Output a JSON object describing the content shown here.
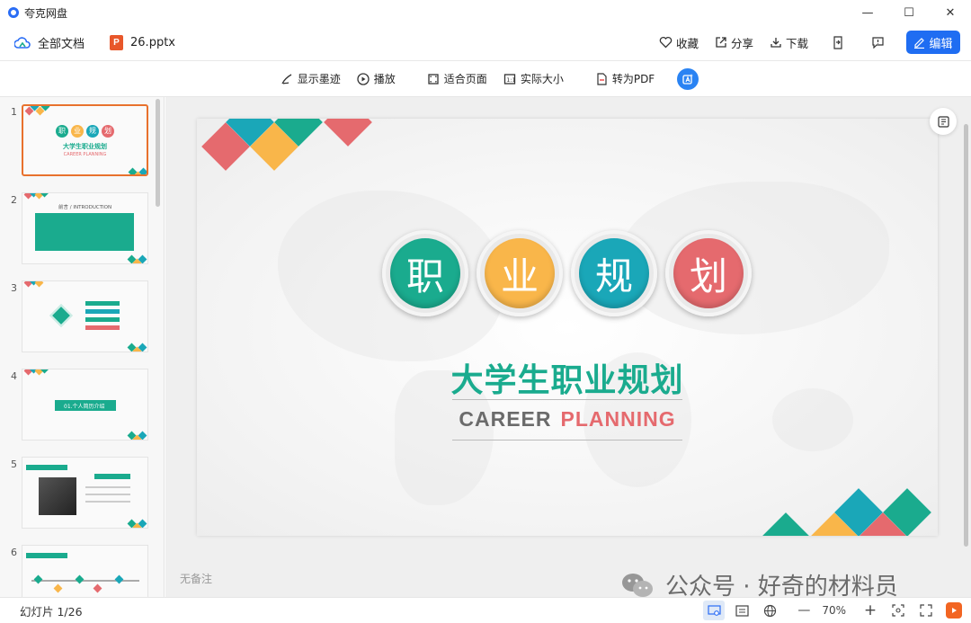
{
  "window": {
    "title": "夸克网盘",
    "minimize": "—",
    "maximize": "☐",
    "close": "✕"
  },
  "nav": {
    "all_docs": "全部文档",
    "file_name": "26.pptx",
    "file_icon_letter": "P",
    "actions": {
      "favorite": "收藏",
      "share": "分享",
      "download": "下载"
    },
    "edit": "编辑"
  },
  "toolbar": {
    "show_ink": "显示墨迹",
    "play": "播放",
    "fit_page": "适合页面",
    "actual_size": "实际大小",
    "to_pdf": "转为PDF"
  },
  "thumbnails": [
    {
      "num": "1",
      "title": "大学生职业规划",
      "sub": "CAREER PLANNING"
    },
    {
      "num": "2",
      "title": "前言 / INTRODUCTION"
    },
    {
      "num": "3"
    },
    {
      "num": "4",
      "title": "01.个人简历介绍"
    },
    {
      "num": "5"
    },
    {
      "num": "6"
    }
  ],
  "slide": {
    "chars": [
      "职",
      "业",
      "规",
      "划"
    ],
    "title": "大学生职业规划",
    "sub_a": "CAREER",
    "sub_b": "PLANNING"
  },
  "notes": "无备注",
  "watermark": "公众号 · 好奇的材料员",
  "status": {
    "slide_count": "幻灯片 1/26",
    "zoom": "70%",
    "zoom_out": "—",
    "zoom_in": "+"
  },
  "colors": {
    "green": "#1aab8e",
    "orange": "#f9b64a",
    "teal": "#1aa7b8",
    "red": "#e56a6e",
    "accent": "#1f6df2"
  }
}
